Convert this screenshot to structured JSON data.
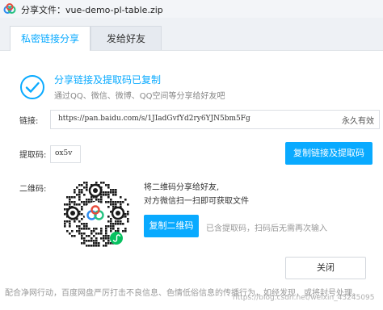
{
  "window": {
    "title": "分享文件：vue-demo-pl-table.zip"
  },
  "tabs": [
    {
      "label": "私密链接分享",
      "active": true
    },
    {
      "label": "发给好友",
      "active": false
    }
  ],
  "success": {
    "title": "分享链接及提取码已复制",
    "subtitle": "通过QQ、微信、微博、QQ空间等分享给好友吧"
  },
  "link": {
    "label": "链接:",
    "value": "https://pan.baidu.com/s/1JIadGvfYd2ry6YJN5bm5Fg",
    "validity": "永久有效"
  },
  "code": {
    "label": "提取码:",
    "value": "ox5v"
  },
  "buttons": {
    "copy_link": "复制链接及提取码",
    "copy_qr": "复制二维码",
    "close": "关闭"
  },
  "qr": {
    "label": "二维码:",
    "hint_line1": "将二维码分享给好友,",
    "hint_line2": "对方微信扫一扫即可获取文件",
    "note": "已含提取码，扫码后无需再次输入"
  },
  "footer": {
    "notice": "配合净网行动，百度网盘严厉打击不良信息、色情低俗信息的传播行为，如经发现，或将封号处理。",
    "watermark": "https://blog.csdn.net/weixin_43245095"
  },
  "colors": {
    "accent": "#09aaff",
    "muted": "#999999"
  },
  "icons": {
    "app": "baidu-cloud-icon",
    "success": "check-circle-icon",
    "qr_center": "baidu-cloud-icon",
    "qr_badge": "wechat-mini-program-icon"
  }
}
